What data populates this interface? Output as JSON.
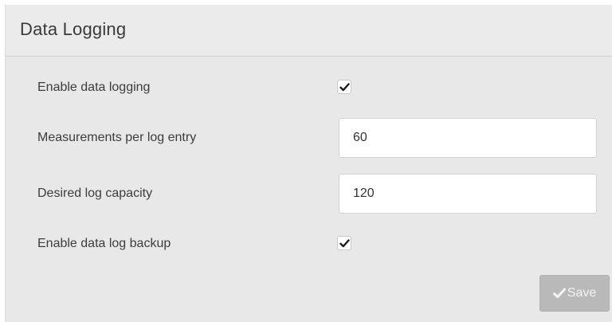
{
  "panel": {
    "title": "Data Logging"
  },
  "fields": {
    "enable_logging": {
      "label": "Enable data logging",
      "checked": true
    },
    "measurements_per_entry": {
      "label": "Measurements per log entry",
      "value": "60"
    },
    "log_capacity": {
      "label": "Desired log capacity",
      "value": "120"
    },
    "enable_backup": {
      "label": "Enable data log backup",
      "checked": true
    }
  },
  "actions": {
    "save_label": "Save",
    "save_icon": "checkmark-icon"
  }
}
